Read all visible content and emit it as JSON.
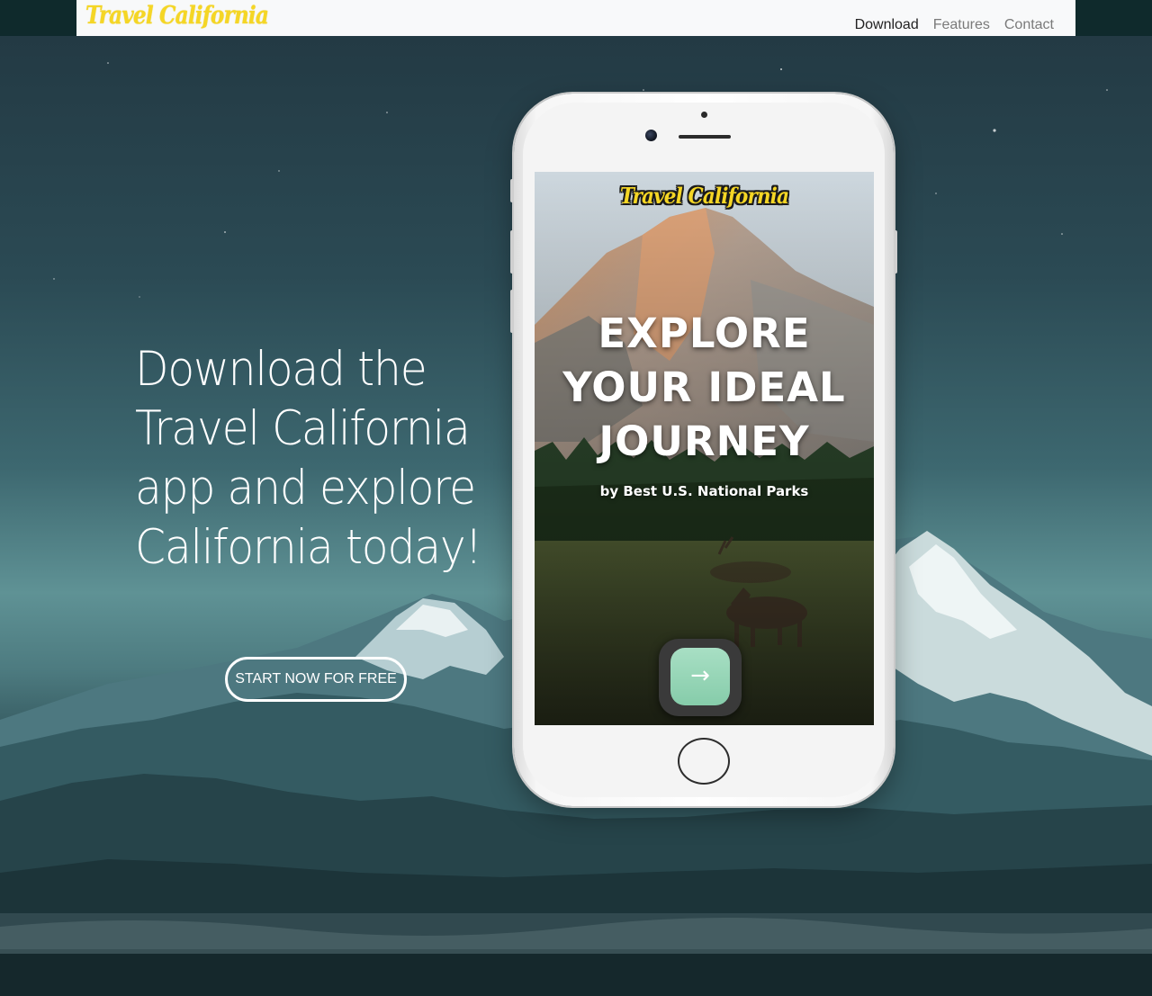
{
  "navbar": {
    "brand": "Travel California",
    "links": [
      "Download",
      "Features",
      "Contact"
    ],
    "active_link": "Download",
    "brand_color": "#f5d625"
  },
  "hero": {
    "headline": "Download the Travel California app and explore California today!",
    "cta_label": "START NOW FOR FREE"
  },
  "phone_screen": {
    "logo": "Travel California",
    "headline_lines": [
      "EXPLORE",
      "YOUR IDEAL",
      "JOURNEY"
    ],
    "subtitle": "by Best U.S. National Parks",
    "next_icon": "arrow-right-icon",
    "next_glyph": "→",
    "button_color": "#94d5b6"
  }
}
